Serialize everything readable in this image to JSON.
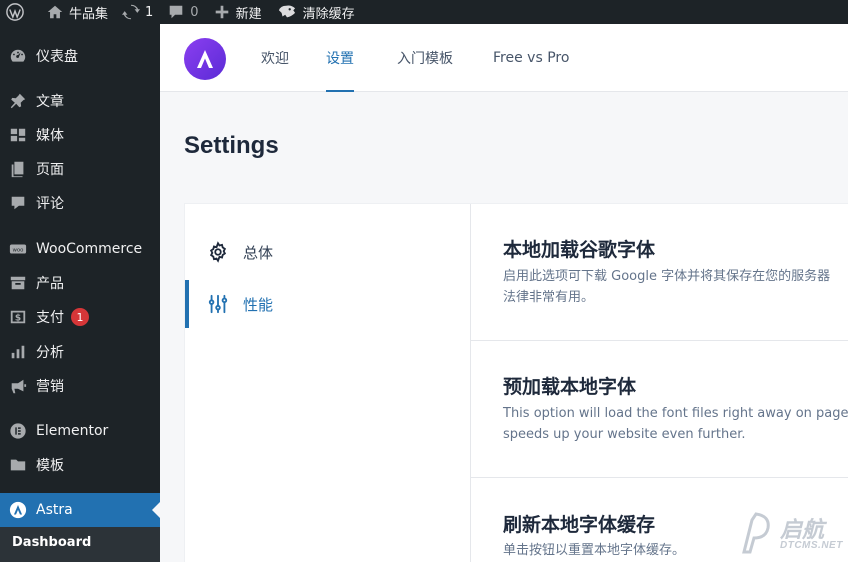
{
  "adminbar": {
    "site_name": "牛品集",
    "updates_count": "1",
    "comments_count": "0",
    "new_label": "新建",
    "cache_label": "清除缓存"
  },
  "sidebar": {
    "items": [
      {
        "label": "仪表盘",
        "icon": "dashboard-icon"
      },
      {
        "label": "文章",
        "icon": "pin-icon"
      },
      {
        "label": "媒体",
        "icon": "media-icon"
      },
      {
        "label": "页面",
        "icon": "page-icon"
      },
      {
        "label": "评论",
        "icon": "comment-icon"
      },
      {
        "label": "WooCommerce",
        "icon": "woo-icon"
      },
      {
        "label": "产品",
        "icon": "archive-icon"
      },
      {
        "label": "支付",
        "icon": "payment-icon",
        "badge": "1"
      },
      {
        "label": "分析",
        "icon": "chart-bar-icon"
      },
      {
        "label": "营销",
        "icon": "megaphone-icon"
      },
      {
        "label": "Elementor",
        "icon": "elementor-icon"
      },
      {
        "label": "模板",
        "icon": "folder-icon"
      },
      {
        "label": "Astra",
        "icon": "astra-icon"
      }
    ],
    "submenu_label": "Dashboard"
  },
  "tabs": [
    "欢迎",
    "设置",
    "入门模板",
    "Free vs Pro"
  ],
  "active_tab": "设置",
  "page_title": "Settings",
  "settings_nav": [
    {
      "label": "总体",
      "icon": "gear-icon"
    },
    {
      "label": "性能",
      "icon": "sliders-icon"
    }
  ],
  "sections": [
    {
      "title": "本地加载谷歌字体",
      "desc_1": "启用此选项可下载 Google 字体并将其保存在您的服务器",
      "desc_2": "法律非常有用。"
    },
    {
      "title": "预加载本地字体",
      "desc_1": "This option will load the font files right away on page",
      "desc_2": "speeds up your website even further."
    },
    {
      "title": "刷新本地字体缓存",
      "desc_1": "单击按钮以重置本地字体缓存。",
      "desc_2": ""
    }
  ],
  "watermark": {
    "cn": "启航",
    "en": "DTCMS.NET"
  },
  "colors": {
    "accent": "#2271b1",
    "admin_dark": "#1d2327",
    "badge": "#d63638",
    "astra_purple": "#7b3ae4"
  }
}
